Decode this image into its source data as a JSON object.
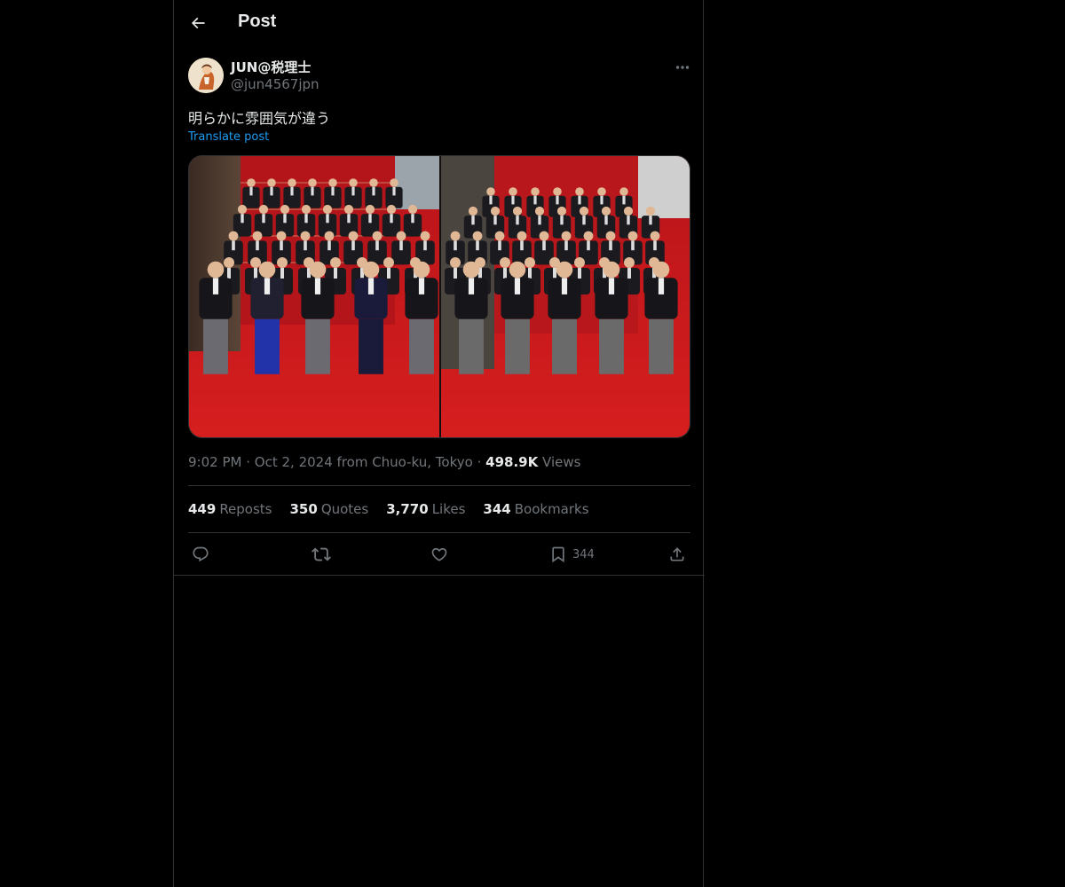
{
  "header": {
    "title": "Post",
    "back_icon": "arrow-left-icon"
  },
  "author": {
    "display_name": "JUN@税理士",
    "handle": "@jun4567jpn",
    "avatar_icon": "avatar-image"
  },
  "post": {
    "text": "明らかに雰囲気が違う",
    "translate_label": "Translate post",
    "media_description_icon": "photo-cabinet-comparison"
  },
  "meta": {
    "time": "9:02 PM",
    "separator": "·",
    "date_location": "Oct 2, 2024 from Chuo-ku, Tokyo",
    "views_count": "498.9K",
    "views_label": "Views"
  },
  "stats": [
    {
      "count": "449",
      "label": "Reposts"
    },
    {
      "count": "350",
      "label": "Quotes"
    },
    {
      "count": "3,770",
      "label": "Likes"
    },
    {
      "count": "344",
      "label": "Bookmarks"
    }
  ],
  "actions": {
    "bookmark_count": "344"
  },
  "colors": {
    "background": "#000000",
    "text_primary": "#e7e9ea",
    "text_secondary": "#71767b",
    "link": "#1d9bf0",
    "border": "#2f3336"
  }
}
